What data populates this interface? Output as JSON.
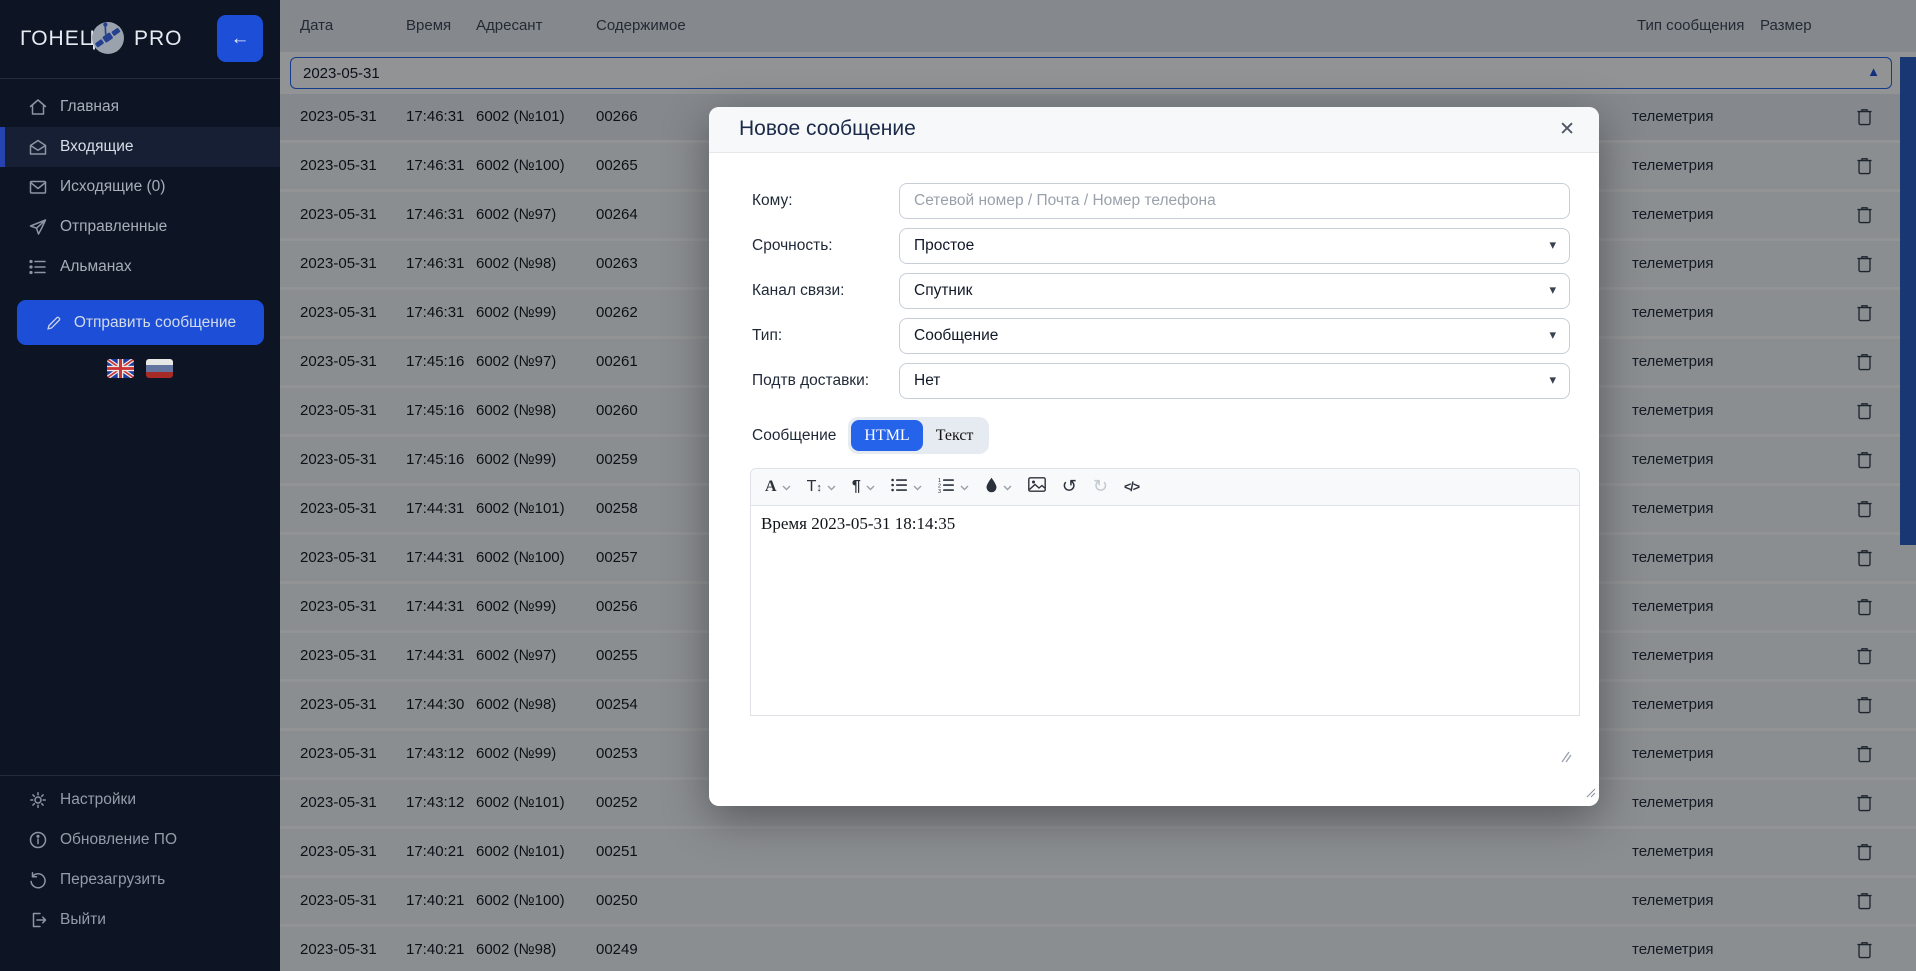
{
  "sidebar": {
    "brand_left": "ГОНЕЦ",
    "brand_right": "PRO",
    "collapse_icon": "←",
    "menu": [
      {
        "label": "Главная",
        "icon": "home-icon",
        "active": false
      },
      {
        "label": "Входящие",
        "icon": "mail-open-icon",
        "active": true
      },
      {
        "label": "Исходящие (0)",
        "icon": "mail-icon",
        "active": false
      },
      {
        "label": "Отправленные",
        "icon": "send-icon",
        "active": false
      },
      {
        "label": "Альманах",
        "icon": "list-icon",
        "active": false
      }
    ],
    "send_button_label": "Отправить сообщение",
    "languages": [
      {
        "icon": "uk-flag"
      },
      {
        "icon": "ru-flag"
      }
    ],
    "footer": [
      {
        "label": "Настройки",
        "icon": "gear-icon"
      },
      {
        "label": "Обновление ПО",
        "icon": "info-icon"
      },
      {
        "label": "Перезагрузить",
        "icon": "refresh-icon"
      },
      {
        "label": "Выйти",
        "icon": "logout-icon"
      }
    ]
  },
  "table": {
    "headers": {
      "date": "Дата",
      "time": "Время",
      "sender": "Адресант",
      "content": "Содержимое",
      "type": "Тип сообщения",
      "size": "Размер"
    },
    "filter_value": "2023-05-31",
    "sort_indicator": "▲",
    "rows": [
      {
        "date": "2023-05-31",
        "time": "17:46:31",
        "sender": "6002 (№101)",
        "content": "00266",
        "type": "телеметрия",
        "selected": true
      },
      {
        "date": "2023-05-31",
        "time": "17:46:31",
        "sender": "6002 (№100)",
        "content": "00265",
        "type": "телеметрия",
        "selected": false
      },
      {
        "date": "2023-05-31",
        "time": "17:46:31",
        "sender": "6002 (№97)",
        "content": "00264",
        "type": "телеметрия",
        "selected": false
      },
      {
        "date": "2023-05-31",
        "time": "17:46:31",
        "sender": "6002 (№98)",
        "content": "00263",
        "type": "телеметрия",
        "selected": false
      },
      {
        "date": "2023-05-31",
        "time": "17:46:31",
        "sender": "6002 (№99)",
        "content": "00262",
        "type": "телеметрия",
        "selected": false
      },
      {
        "date": "2023-05-31",
        "time": "17:45:16",
        "sender": "6002 (№97)",
        "content": "00261",
        "type": "телеметрия",
        "selected": false
      },
      {
        "date": "2023-05-31",
        "time": "17:45:16",
        "sender": "6002 (№98)",
        "content": "00260",
        "type": "телеметрия",
        "selected": false
      },
      {
        "date": "2023-05-31",
        "time": "17:45:16",
        "sender": "6002 (№99)",
        "content": "00259",
        "type": "телеметрия",
        "selected": false
      },
      {
        "date": "2023-05-31",
        "time": "17:44:31",
        "sender": "6002 (№101)",
        "content": "00258",
        "type": "телеметрия",
        "selected": false
      },
      {
        "date": "2023-05-31",
        "time": "17:44:31",
        "sender": "6002 (№100)",
        "content": "00257",
        "type": "телеметрия",
        "selected": false
      },
      {
        "date": "2023-05-31",
        "time": "17:44:31",
        "sender": "6002 (№99)",
        "content": "00256",
        "type": "телеметрия",
        "selected": false
      },
      {
        "date": "2023-05-31",
        "time": "17:44:31",
        "sender": "6002 (№97)",
        "content": "00255",
        "type": "телеметрия",
        "selected": false
      },
      {
        "date": "2023-05-31",
        "time": "17:44:30",
        "sender": "6002 (№98)",
        "content": "00254",
        "type": "телеметрия",
        "selected": false
      },
      {
        "date": "2023-05-31",
        "time": "17:43:12",
        "sender": "6002 (№99)",
        "content": "00253",
        "type": "телеметрия",
        "selected": false
      },
      {
        "date": "2023-05-31",
        "time": "17:43:12",
        "sender": "6002 (№101)",
        "content": "00252",
        "type": "телеметрия",
        "selected": false
      },
      {
        "date": "2023-05-31",
        "time": "17:40:21",
        "sender": "6002 (№101)",
        "content": "00251",
        "type": "телеметрия",
        "selected": false
      },
      {
        "date": "2023-05-31",
        "time": "17:40:21",
        "sender": "6002 (№100)",
        "content": "00250",
        "type": "телеметрия",
        "selected": false
      },
      {
        "date": "2023-05-31",
        "time": "17:40:21",
        "sender": "6002 (№98)",
        "content": "00249",
        "type": "телеметрия",
        "selected": false
      }
    ]
  },
  "modal": {
    "title": "Новое сообщение",
    "close_icon": "✕",
    "to_label": "Кому:",
    "to_placeholder": "Сетевой номер / Почта / Номер телефона",
    "selects": [
      {
        "label": "Срочность:",
        "value": "Простое"
      },
      {
        "label": "Канал связи:",
        "value": "Спутник"
      },
      {
        "label": "Тип:",
        "value": "Сообщение"
      },
      {
        "label": "Подтв доставки:",
        "value": "Нет"
      }
    ],
    "message_label": "Сообщение",
    "modes": [
      {
        "label": "HTML",
        "active": true
      },
      {
        "label": "Текст",
        "active": false
      }
    ],
    "toolbar": [
      {
        "icon": "font-family-icon",
        "chevron": true,
        "disabled": false
      },
      {
        "icon": "font-size-icon",
        "chevron": true,
        "disabled": false
      },
      {
        "icon": "paragraph-icon",
        "chevron": true,
        "disabled": false
      },
      {
        "icon": "unordered-list-icon",
        "chevron": true,
        "disabled": false
      },
      {
        "icon": "ordered-list-icon",
        "chevron": true,
        "disabled": false
      },
      {
        "icon": "text-color-icon",
        "chevron": true,
        "disabled": false
      },
      {
        "icon": "image-icon",
        "chevron": false,
        "disabled": false
      },
      {
        "icon": "undo-icon",
        "chevron": false,
        "disabled": false
      },
      {
        "icon": "redo-icon",
        "chevron": false,
        "disabled": true
      },
      {
        "icon": "code-view-icon",
        "chevron": false,
        "disabled": false
      }
    ],
    "editor_content": "Время 2023-05-31 18:14:35"
  },
  "colors": {
    "accent": "#1d4ed8",
    "modal_accent": "#2563eb",
    "sidebar_bg": "#0d1524"
  }
}
